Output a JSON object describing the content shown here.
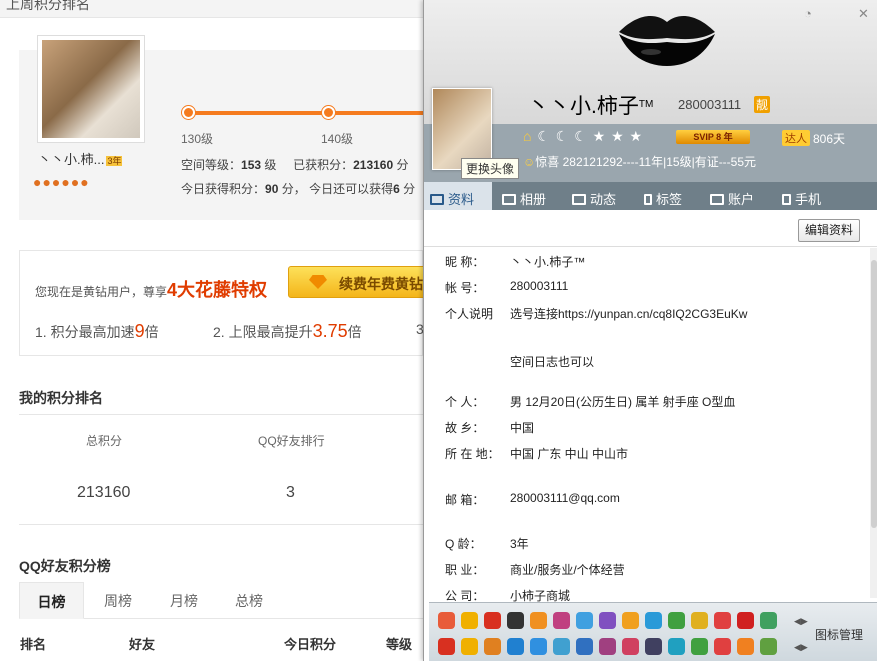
{
  "background": {
    "title": "上周积分排名",
    "nickname": "丶丶小.柿...",
    "year_badge": "3年",
    "levels": [
      "130级",
      "140级"
    ],
    "space_level_label": "空间等级：",
    "space_level": "153",
    "level_unit": "级",
    "earned_label": "已获积分：",
    "earned": "213160",
    "earned_unit": "分",
    "today_label": "今日获得积分：",
    "today": "90",
    "today_unit": "分，",
    "remaining_label": "今日还可以获得",
    "remaining": "6",
    "remaining_unit": "分",
    "vip_text": "您现在是黄钻用户，尊享",
    "vip_highlight": "4大花藤特权",
    "vip_button": "续费年费黄钻",
    "perk1_text": "1. 积分最高加速",
    "perk1_value": "9",
    "perk1_unit": "倍",
    "perk2_text": "2. 上限最高提升",
    "perk2_value": "3.75",
    "perk2_unit": "倍",
    "perk3_text": "3",
    "my_rank_title": "我的积分排名",
    "rank_headers": [
      "总积分",
      "QQ好友排行"
    ],
    "rank_values": [
      "213160",
      "3"
    ],
    "friend_rank_title": "QQ好友积分榜",
    "tabs": [
      "日榜",
      "周榜",
      "月榜",
      "总榜"
    ],
    "table_headers": [
      "排名",
      "好友",
      "今日积分",
      "等级"
    ]
  },
  "card": {
    "display_name": "丶丶小.柿子",
    "tm": "TM",
    "qq": "280003111",
    "vip_tag": "靓",
    "svip": "SVIP 8 年",
    "talent_badge": "达人",
    "days": "806天",
    "signature": "惊喜  282121292----11年|15级|有证---55元",
    "avatar_tooltip": "更换头像",
    "nav": [
      "资料",
      "相册",
      "动态",
      "标签",
      "账户",
      "手机"
    ],
    "edit_button": "编辑资料",
    "info": [
      {
        "k": "昵    称：",
        "v": "丶丶小.柿子™"
      },
      {
        "k": "帐    号：",
        "v": "280003111"
      },
      {
        "k": "个人说明",
        "v": "选号连接https://yunpan.cn/cq8IQ2CG3EuKw"
      },
      {
        "k": "",
        "v": "空间日志也可以"
      },
      {
        "k": "个    人：",
        "v": "男    12月20日(公历生日)    属羊    射手座    O型血"
      },
      {
        "k": "故    乡：",
        "v": "中国"
      },
      {
        "k": "所 在 地：",
        "v": "中国 广东 中山 中山市"
      },
      {
        "k": "邮    箱：",
        "v": "280003111@qq.com"
      },
      {
        "k": "Q    龄：",
        "v": "3年"
      },
      {
        "k": "职    业：",
        "v": "商业/服务业/个体经营"
      },
      {
        "k": "公    司：",
        "v": "小柿子商城"
      }
    ],
    "icon_manager": "图标管理",
    "colors": {
      "nav_bg": "#6f7f89",
      "sub_bg": "#9aa6ae",
      "accent": "#f57b1e"
    }
  }
}
